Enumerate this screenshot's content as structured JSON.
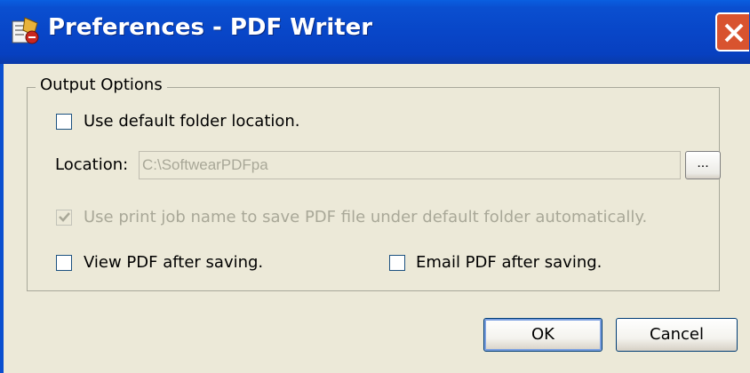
{
  "window": {
    "title": "Preferences - PDF Writer",
    "title_bar_color": "#0846c8",
    "close_color": "#d8532f"
  },
  "group": {
    "legend": "Output Options"
  },
  "options": {
    "use_default_folder": {
      "label": "Use default folder location.",
      "checked": false
    },
    "location": {
      "label": "Location:",
      "value": "C:\\SoftwearPDFpa",
      "browse_label": "..."
    },
    "use_print_job_name": {
      "label": "Use print job name to save PDF file under default folder automatically.",
      "checked": true,
      "enabled": false
    },
    "view_pdf": {
      "label": "View PDF after saving.",
      "checked": false
    },
    "email_pdf": {
      "label": "Email PDF after saving.",
      "checked": false
    }
  },
  "buttons": {
    "ok": "OK",
    "cancel": "Cancel"
  }
}
